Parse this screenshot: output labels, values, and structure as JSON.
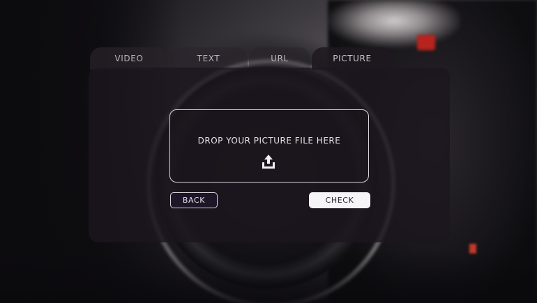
{
  "tabs": [
    {
      "label": "VIDEO"
    },
    {
      "label": "TEXT"
    },
    {
      "label": "URL"
    },
    {
      "label": "PICTURE"
    }
  ],
  "active_tab": "PICTURE",
  "dropzone": {
    "text": "DROP YOUR PICTURE FILE HERE",
    "icon": "upload-icon"
  },
  "buttons": {
    "back_label": "BACK",
    "check_label": "CHECK"
  },
  "colors": {
    "card_bg": "#1c161e",
    "check_button_bg": "#f6f4f7",
    "accent_red": "#b8231d"
  }
}
